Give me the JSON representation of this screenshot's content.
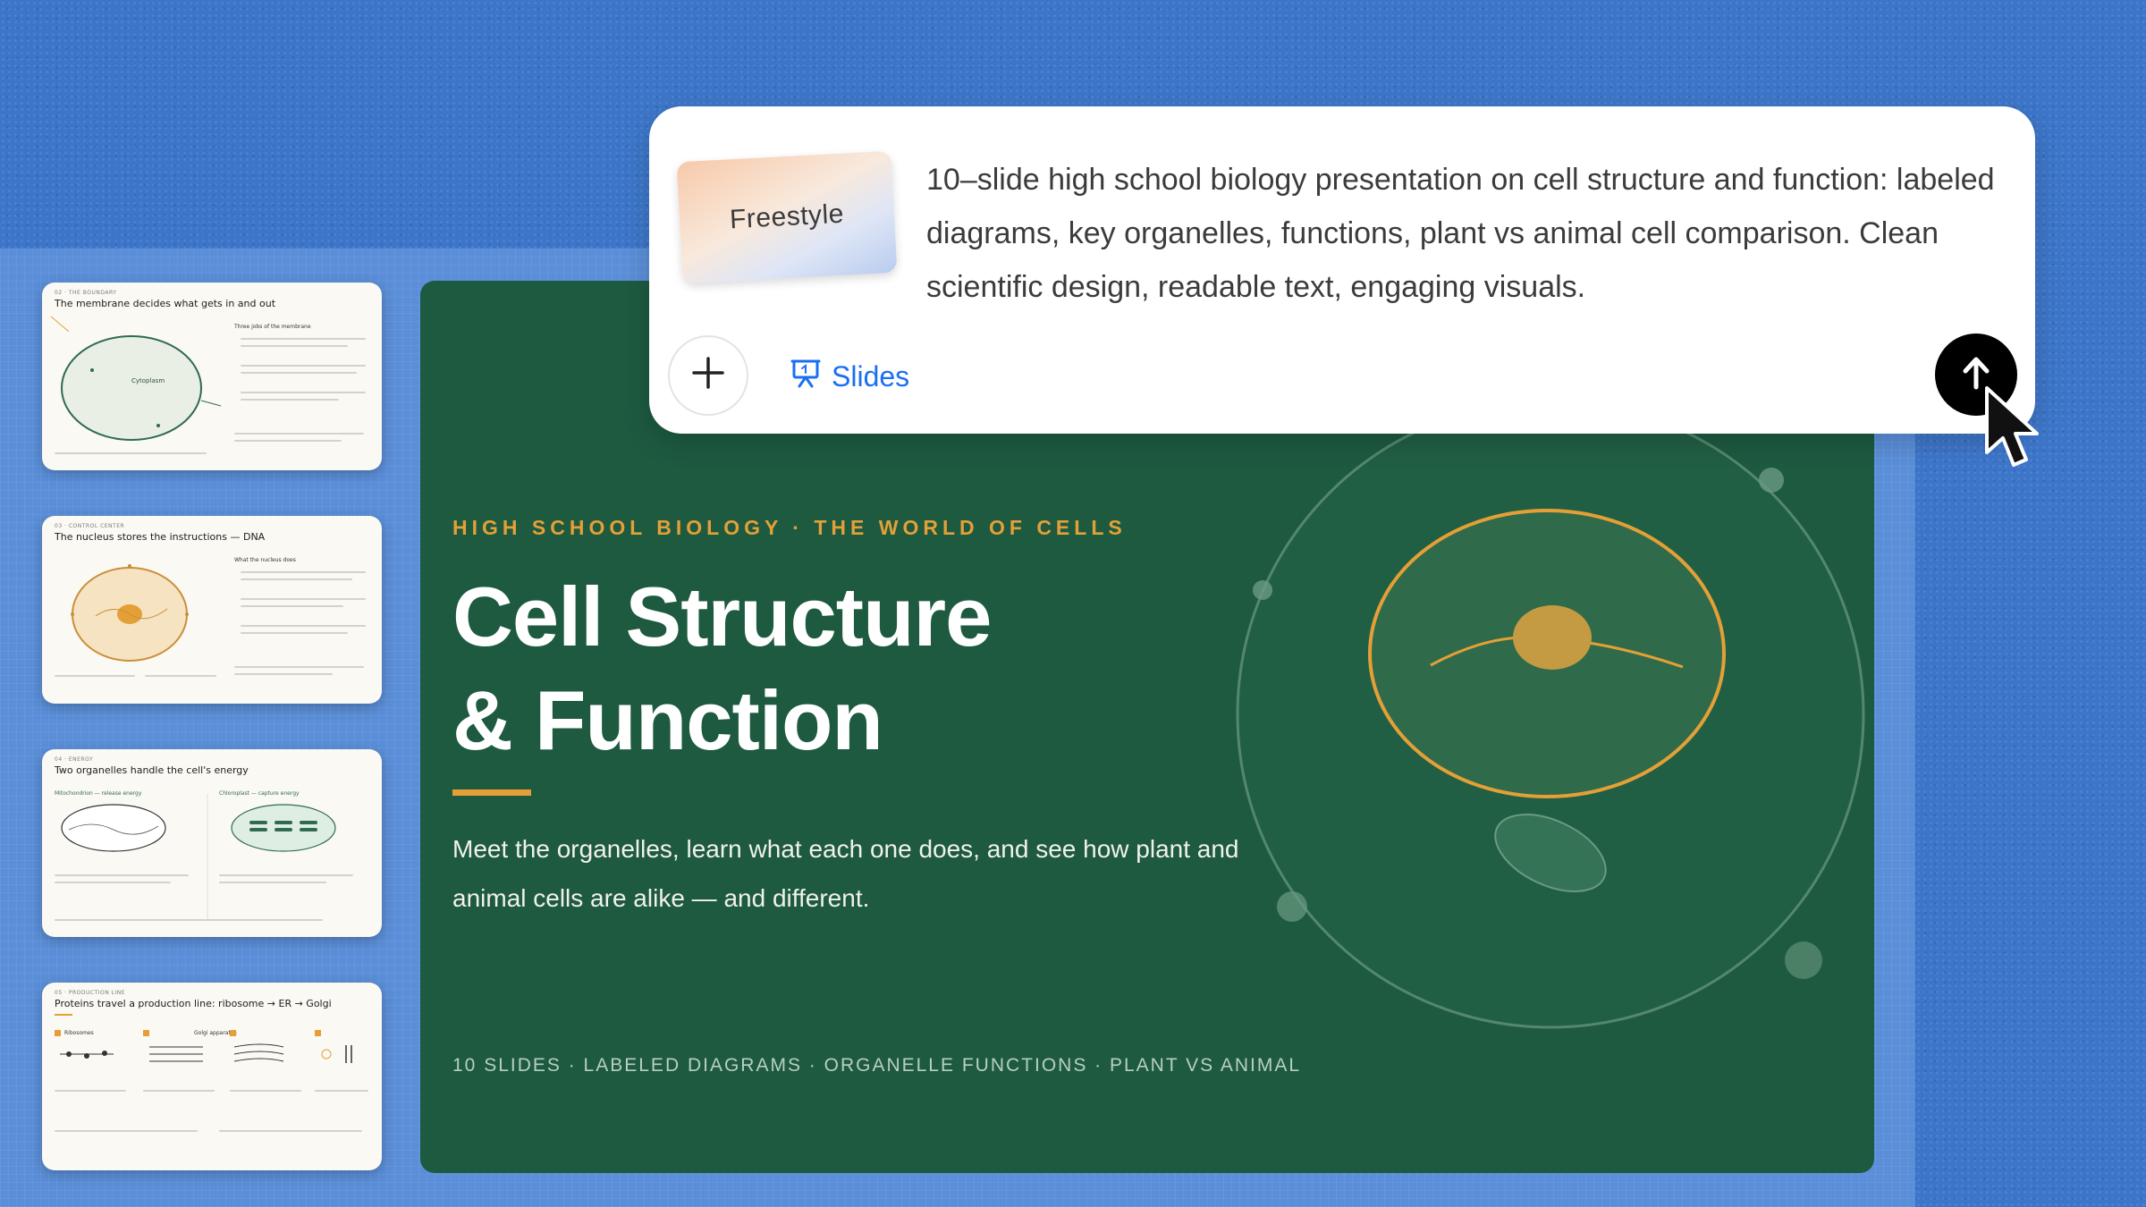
{
  "prompt": {
    "style_label": "Freestyle",
    "text": "10–slide high school biology presentation on cell structure and function: labeled diagrams, key organelles, functions, plant vs animal cell comparison. Clean scientific design, readable text, engaging visuals.",
    "add_icon": "plus-icon",
    "mode_icon": "presentation-icon",
    "mode_label": "Slides",
    "send_icon": "arrow-up-icon"
  },
  "slide": {
    "eyebrow": "HIGH SCHOOL BIOLOGY · THE WORLD OF CELLS",
    "title_line1": "Cell Structure",
    "title_line2": "& Function",
    "subtitle": "Meet the organelles, learn what each one does, and see how plant and animal cells are alike — and different.",
    "meta": "10 SLIDES · LABELED DIAGRAMS · ORGANELLE FUNCTIONS · PLANT VS ANIMAL"
  },
  "thumbnails": [
    {
      "tag": "02 · THE BOUNDARY",
      "title": "The membrane decides what gets in and out",
      "note": "Cytoplasm",
      "side": "Three jobs of the membrane"
    },
    {
      "tag": "03 · CONTROL CENTER",
      "title": "The nucleus stores the instructions — DNA",
      "note": "",
      "side": "What the nucleus does"
    },
    {
      "tag": "04 · ENERGY",
      "title": "Two organelles handle the cell's energy",
      "note": "Mitochondrion — release energy",
      "side": "Chloroplast — capture energy"
    },
    {
      "tag": "05 · PRODUCTION LINE",
      "title": "Proteins travel a production line: ribosome → ER → Golgi",
      "note": "Ribosomes",
      "side": "Golgi apparatus"
    }
  ],
  "colors": {
    "slide_bg": "#1d5a40",
    "accent": "#e4a036",
    "link_blue": "#1a6ff2"
  }
}
